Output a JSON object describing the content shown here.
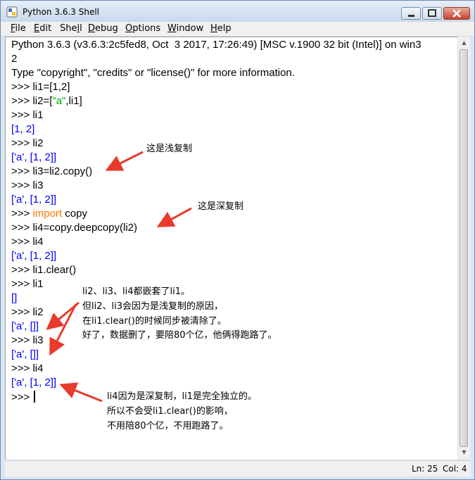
{
  "window": {
    "title": "Python 3.6.3 Shell"
  },
  "menu": [
    {
      "u": "F",
      "rest": "ile"
    },
    {
      "u": "E",
      "rest": "dit"
    },
    {
      "pre": "She",
      "u": "l",
      "rest": "l"
    },
    {
      "u": "D",
      "rest": "ebug"
    },
    {
      "u": "O",
      "rest": "ptions"
    },
    {
      "u": "W",
      "rest": "indow"
    },
    {
      "u": "H",
      "rest": "elp"
    }
  ],
  "shell": {
    "banner1": "Python 3.6.3 (v3.6.3:2c5fed8, Oct  3 2017, 17:26:49) [MSC v.1900 32 bit (Intel)] on win3",
    "banner2": "2",
    "banner3": "Type \"copyright\", \"credits\" or \"license()\" for more information.",
    "prompt": ">>> ",
    "lines": {
      "l1": "li1=[1,2]",
      "l2a": "li2=[",
      "l2s": "\"a\"",
      "l2b": ",li1]",
      "l3": "li1",
      "o3": "[1, 2]",
      "l4": "li2",
      "o4": "['a', [1, 2]]",
      "l5": "li3=li2.copy()",
      "l6": "li3",
      "o6": "['a', [1, 2]]",
      "l7kw": "import",
      "l7": " copy",
      "l8": "li4=copy.deepcopy(li2)",
      "l9": "li4",
      "o9": "['a', [1, 2]]",
      "l10": "li1.clear()",
      "l11": "li1",
      "o11": "[]",
      "l12": "li2",
      "o12": "['a', []]",
      "l13": "li3",
      "o13": "['a', []]",
      "l14": "li4",
      "o14": "['a', [1, 2]]"
    }
  },
  "annotations": {
    "shallow": "这是浅复制",
    "deep": "这是深复制",
    "nested1": "li2、li3、li4都嵌套了li1。",
    "nested2": "但li2、li3会因为是浅复制的原因，",
    "nested3": "在li1.clear()的时候同步被清除了。",
    "nested4": "好了，数据删了，要陪80个亿，他俩得跑路了。",
    "indep1": "li4因为是深复制，li1是完全独立的。",
    "indep2": "所以不会受li1.clear()的影响，",
    "indep3": "不用陪80个亿，不用跑路了。"
  },
  "status": {
    "ln": "Ln: 25",
    "col": "Col: 4"
  },
  "colors": {
    "output": "#0000ff",
    "string": "#00aa00",
    "keyword": "#ff7700",
    "arrow": "#e83b2c"
  }
}
